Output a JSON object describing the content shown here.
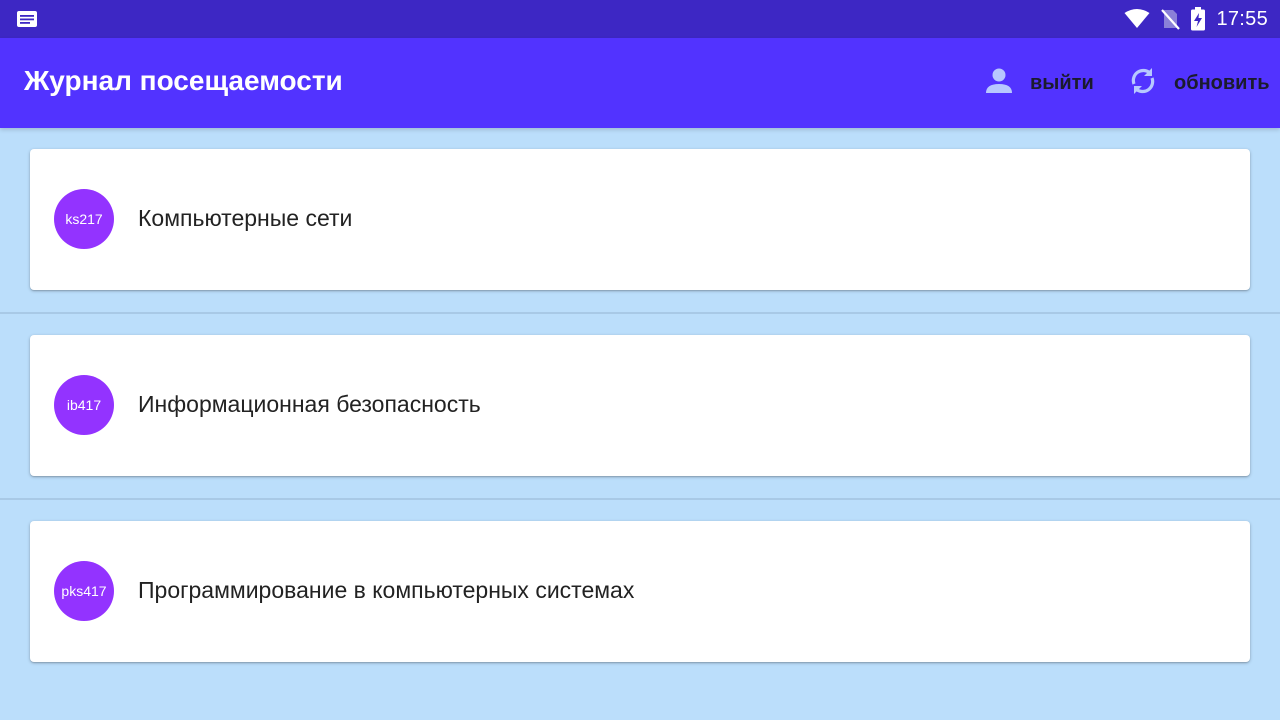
{
  "status_bar": {
    "time": "17:55",
    "icons": [
      "notification-icon",
      "wifi-icon",
      "no-sim-icon",
      "battery-charging-icon"
    ]
  },
  "app_bar": {
    "title": "Журнал посещаемости",
    "logout_label": "выйти",
    "refresh_label": "обновить",
    "logout_icon": "person-icon",
    "refresh_icon": "refresh-icon"
  },
  "colors": {
    "status_bar": "#3d27c4",
    "app_bar": "#5233ff",
    "background": "#bbdefb",
    "avatar": "#9333ff",
    "action_icon": "#b7c8ff"
  },
  "courses": [
    {
      "code": "ks217",
      "title": "Компьютерные сети"
    },
    {
      "code": "ib417",
      "title": "Информационная безопасность"
    },
    {
      "code": "pks417",
      "title": "Программирование в компьютерных системах"
    }
  ]
}
